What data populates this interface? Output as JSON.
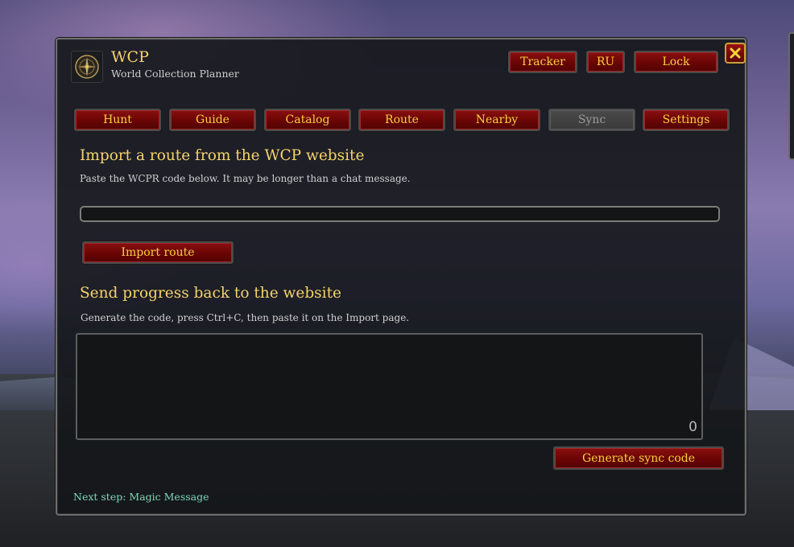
{
  "header": {
    "title": "WCP",
    "subtitle": "World Collection Planner",
    "tracker_label": "Tracker",
    "lang_label": "RU",
    "lock_label": "Lock"
  },
  "tabs": [
    {
      "label": "Hunt",
      "state": "enabled"
    },
    {
      "label": "Guide",
      "state": "enabled"
    },
    {
      "label": "Catalog",
      "state": "enabled"
    },
    {
      "label": "Route",
      "state": "enabled"
    },
    {
      "label": "Nearby",
      "state": "enabled"
    },
    {
      "label": "Sync",
      "state": "selected"
    },
    {
      "label": "Settings",
      "state": "enabled"
    }
  ],
  "import_section": {
    "heading": "Import a route from the WCP website",
    "description": "Paste the WCPR code below. It may be longer than a chat message.",
    "input_value": "",
    "button_label": "Import route"
  },
  "export_section": {
    "heading": "Send progress back to the website",
    "description": "Generate the code, press Ctrl+C, then paste it on the Import page.",
    "char_count": "0",
    "button_label": "Generate sync code"
  },
  "footer": {
    "next_step": "Next step: Magic Message"
  },
  "colors": {
    "gold_text": "#f5d36b",
    "button_text": "#f5d23f",
    "button_red": "#6a0505",
    "next_step_green": "#7fd6b6"
  },
  "icons": {
    "logo": "compass-emblem-icon",
    "close": "close-icon"
  }
}
